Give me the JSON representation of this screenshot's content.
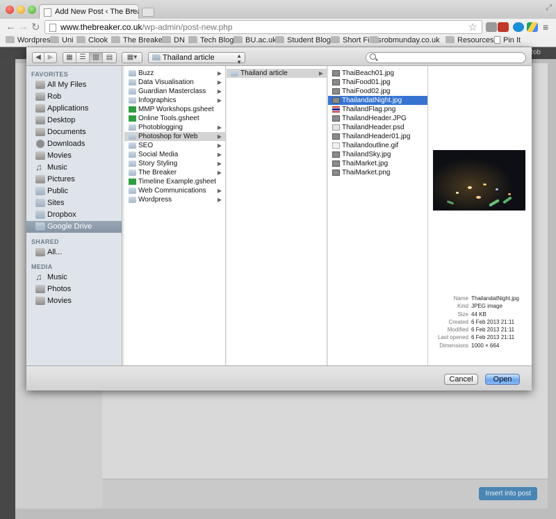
{
  "browser": {
    "tab_title": "Add New Post ‹ The Breaker",
    "url_host": "www.thebreaker.co.uk",
    "url_path": "/wp-admin/post-new.php",
    "bookmarks": [
      "Wordpress",
      "Uni",
      "Clook",
      "The Breaker",
      "DN",
      "Tech Blog",
      "BU.ac.uk",
      "Student Blogs",
      "Short Films",
      "robmunday.co.uk",
      "Resources",
      "Pin It"
    ],
    "user_label": "Rob"
  },
  "sheet": {
    "path_popup": "Thailand article",
    "search_placeholder": "",
    "sidebar": {
      "favorites_header": "FAVORITES",
      "favorites": [
        "All My Files",
        "Rob",
        "Applications",
        "Desktop",
        "Documents",
        "Downloads",
        "Movies",
        "Music",
        "Pictures",
        "Public",
        "Sites",
        "Dropbox",
        "Google Drive"
      ],
      "shared_header": "SHARED",
      "shared": [
        "All..."
      ],
      "media_header": "MEDIA",
      "media": [
        "Music",
        "Photos",
        "Movies"
      ]
    },
    "column1": [
      "Buzz",
      "Data Visualisation",
      "Guardian Masterclass",
      "Infographics",
      "MMP Workshops.gsheet",
      "Online Tools.gsheet",
      "Photoblogging",
      "Photoshop for Web",
      "SEO",
      "Social Media",
      "Story Styling",
      "The Breaker",
      "Timeline Example.gsheet",
      "Web Communications",
      "Wordpress"
    ],
    "column2": [
      "Thailand article"
    ],
    "column3": [
      "ThaiBeach01.jpg",
      "ThaiFood01.jpg",
      "ThaiFood02.jpg",
      "ThailandatNight.jpg",
      "ThailandFlag.png",
      "ThailandHeader.JPG",
      "ThailandHeader.psd",
      "ThailandHeader01.jpg",
      "Thailandoutline.gif",
      "ThailandSky.jpg",
      "ThaiMarket.jpg",
      "ThaiMarket.png"
    ],
    "preview": {
      "info": [
        {
          "k": "Name",
          "v": "ThailandatNight.jpg"
        },
        {
          "k": "Kind",
          "v": "JPEG image"
        },
        {
          "k": "Size",
          "v": "44 KB"
        },
        {
          "k": "Created",
          "v": "6 Feb 2013 21:11"
        },
        {
          "k": "Modified",
          "v": "6 Feb 2013 21:11"
        },
        {
          "k": "Last opened",
          "v": "6 Feb 2013 21:11"
        },
        {
          "k": "Dimensions",
          "v": "1000 × 664"
        }
      ]
    },
    "cancel_label": "Cancel",
    "open_label": "Open"
  },
  "page_behind": {
    "insert_label": "Insert into post"
  },
  "colors": {
    "selection_blue": "#3774d2",
    "sidebar_bg": "#dee4ea",
    "wp_dark": "#464646"
  }
}
